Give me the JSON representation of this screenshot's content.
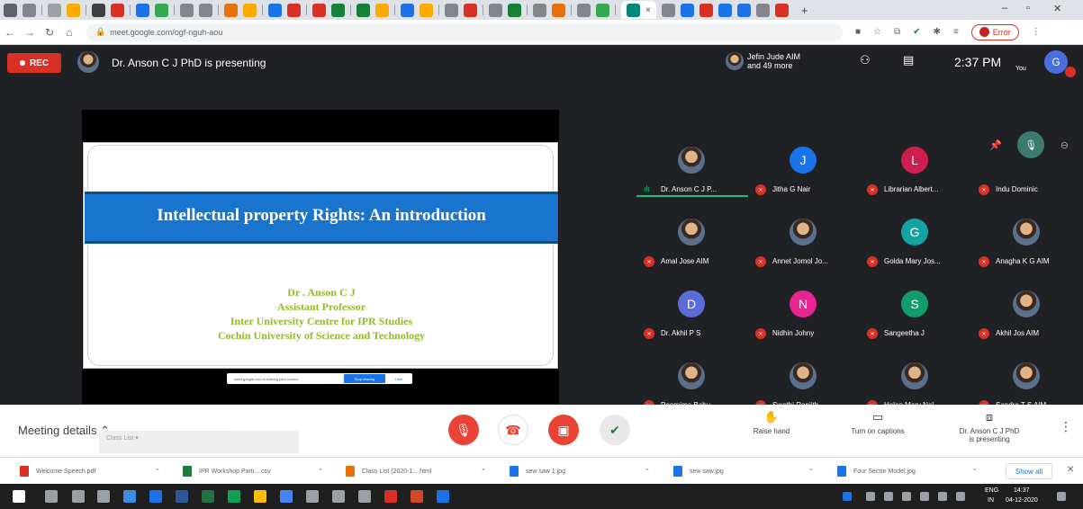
{
  "browser": {
    "address": "meet.google.com/ogf-nguh-aou",
    "profile_label": "Error",
    "active_tab_close": "×",
    "new_tab": "+",
    "win_min": "–",
    "win_max": "▫",
    "win_close": "✕"
  },
  "meet_header": {
    "rec_label": "REC",
    "presenting_text": "Dr. Anson C J PhD is presenting",
    "people_line1": "Jefin Jude AIM",
    "people_line2": "and 49 more",
    "time": "2:37 PM",
    "you_label": "You",
    "user_initial": "G"
  },
  "slide": {
    "title": "Intellectual property Rights: An introduction",
    "lines": [
      "Dr . Anson C J",
      "Assistant Professor",
      "Inter University Centre for IPR Studies",
      "Cochin University of Science and Technology"
    ],
    "share_notice": "meet.google.com is sharing your screen.",
    "stop_sharing": "Stop sharing",
    "hide": "Hide"
  },
  "participants": [
    {
      "name": "Dr. Anson C J P...",
      "initial": "",
      "color": "#5f6368",
      "photo": true,
      "speaking": true
    },
    {
      "name": "Jitha G Nair",
      "initial": "J",
      "color": "#1a73e8",
      "photo": false
    },
    {
      "name": "Librarian Albert...",
      "initial": "L",
      "color": "#d01d4f",
      "photo": false
    },
    {
      "name": "Indu Dominic",
      "initial": "",
      "color": "#5f6368",
      "photo": false,
      "hidden_avatar": true
    },
    {
      "name": "Amal Jose AIM",
      "initial": "",
      "color": "#5f6368",
      "photo": true
    },
    {
      "name": "Annet Jomol Jo...",
      "initial": "",
      "color": "#5f6368",
      "photo": true
    },
    {
      "name": "Golda Mary Jos...",
      "initial": "G",
      "color": "#12a4a0",
      "photo": false
    },
    {
      "name": "Anagha K G AIM",
      "initial": "",
      "color": "#5f6368",
      "photo": true
    },
    {
      "name": "Dr. Akhil P S",
      "initial": "D",
      "color": "#5b6cd6",
      "photo": false
    },
    {
      "name": "Nidhin Johny",
      "initial": "N",
      "color": "#e52592",
      "photo": false
    },
    {
      "name": "Sangeetha J",
      "initial": "S",
      "color": "#129c6b",
      "photo": false
    },
    {
      "name": "Akhil Jos AIM",
      "initial": "",
      "color": "#5f6368",
      "photo": true
    },
    {
      "name": "Poornima Babu...",
      "initial": "",
      "color": "#5f6368",
      "photo": true
    },
    {
      "name": "Swathi Renjith ...",
      "initial": "",
      "color": "#5f6368",
      "photo": true
    },
    {
      "name": "Helen Mary Nel...",
      "initial": "",
      "color": "#5f6368",
      "photo": true
    },
    {
      "name": "Sandra T S AIM",
      "initial": "",
      "color": "#5f6368",
      "photo": true
    }
  ],
  "bottom_bar": {
    "meeting_details": "Meeting details",
    "class_list_popup": "Class List ▾",
    "raise_hand": "Raise hand",
    "captions": "Turn on captions",
    "presenting_line1": "Dr. Anson C J PhD",
    "presenting_line2": "is presenting"
  },
  "downloads": [
    {
      "name": "Welcome Speech.pdf",
      "color": "#d93025"
    },
    {
      "name": "IPR Workshop Parti....csv",
      "color": "#188038"
    },
    {
      "name": "Class List (2020-1....html",
      "color": "#e8710a"
    },
    {
      "name": "sew saw 1.jpg",
      "color": "#1a73e8"
    },
    {
      "name": "sew saw.jpg",
      "color": "#1a73e8"
    },
    {
      "name": "Four Sector Model.jpg",
      "color": "#1a73e8"
    }
  ],
  "downloads_showall": "Show all",
  "taskbar": {
    "lang_line1": "ENG",
    "lang_line2": "IN",
    "clock_time": "14:37",
    "clock_date": "04-12-2020"
  }
}
